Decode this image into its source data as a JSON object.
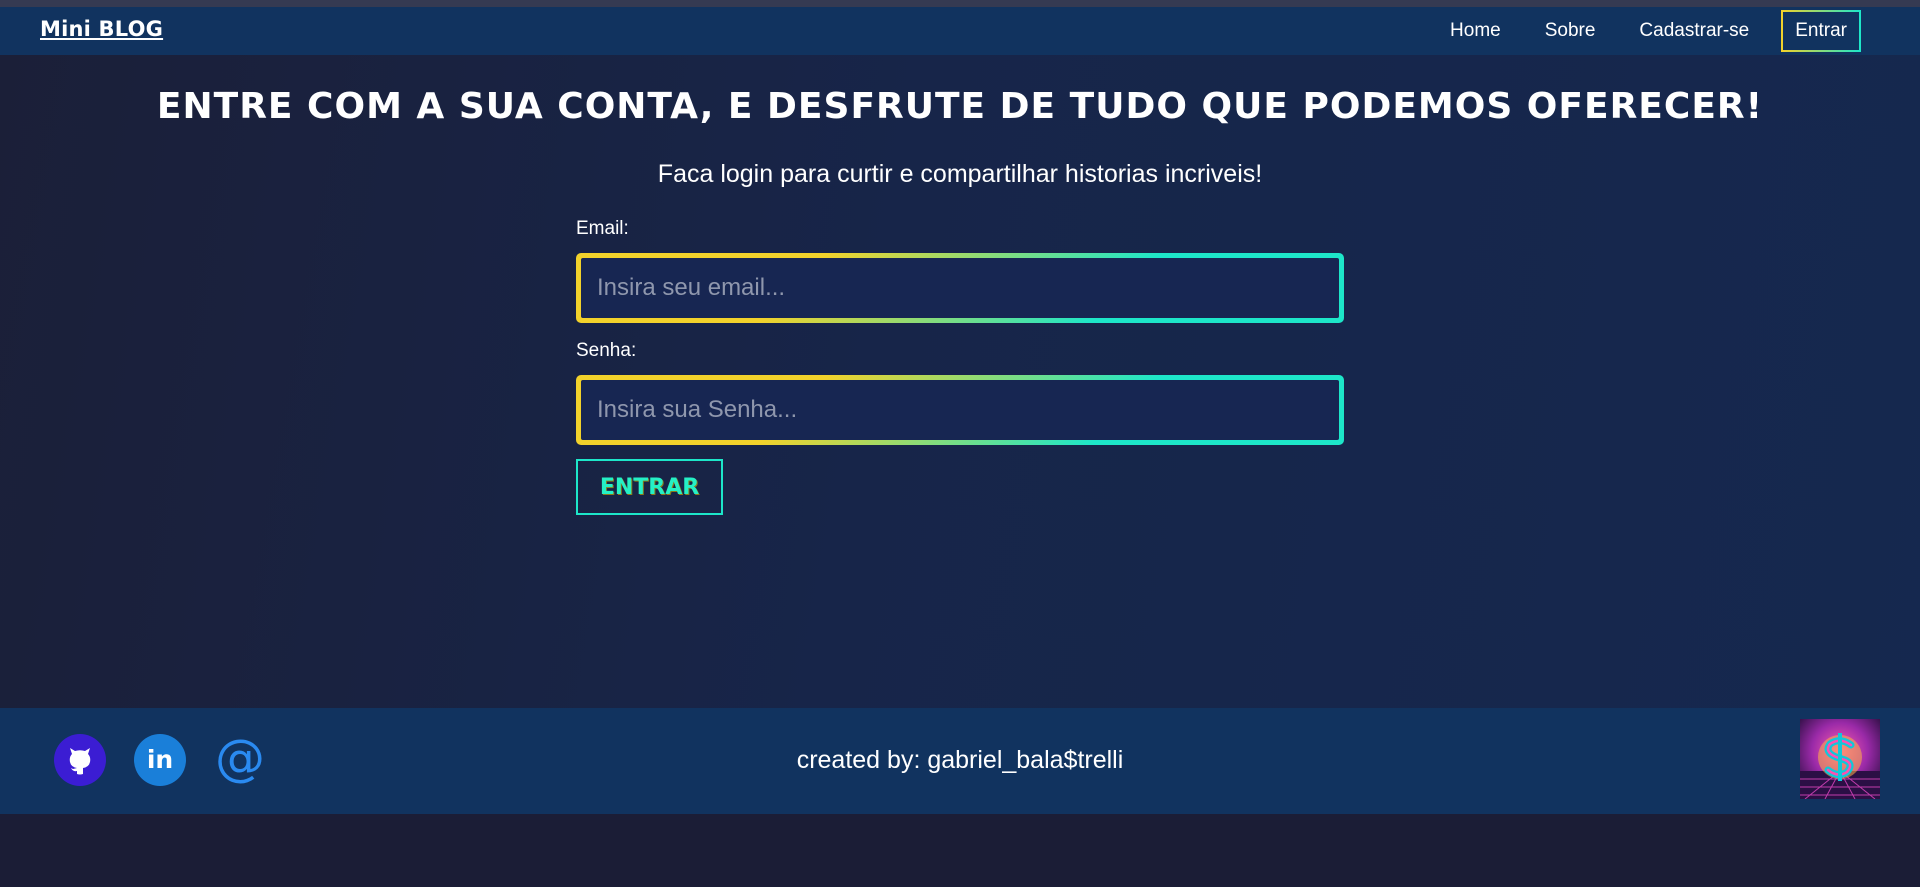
{
  "navbar": {
    "brand": "Mini BLOG",
    "links": [
      {
        "label": "Home"
      },
      {
        "label": "Sobre"
      },
      {
        "label": "Cadastrar-se"
      },
      {
        "label": "Entrar",
        "active": true
      }
    ]
  },
  "main": {
    "headline": "ENTRE COM A SUA CONTA, E DESFRUTE DE TUDO QUE PODEMOS OFERECER!",
    "subtitle": "Faca login para curtir e compartilhar historias incriveis!",
    "form": {
      "email_label": "Email:",
      "email_placeholder": "Insira seu email...",
      "email_value": "",
      "password_label": "Senha:",
      "password_placeholder": "Insira sua Senha...",
      "password_value": "",
      "submit_label": "ENTRAR"
    }
  },
  "footer": {
    "socials": [
      {
        "icon": "github-icon"
      },
      {
        "icon": "linkedin-icon",
        "text": "in"
      },
      {
        "icon": "at-sign-icon",
        "text": "@"
      }
    ],
    "credit": "created by: gabriel_bala$trelli",
    "avatar_icon": "dollar-sign-avatar-icon"
  },
  "colors": {
    "navbar_bg": "#11335f",
    "accent_yellow": "#f2d22b",
    "accent_cyan": "#1de6c9",
    "page_bg": "#172549"
  }
}
